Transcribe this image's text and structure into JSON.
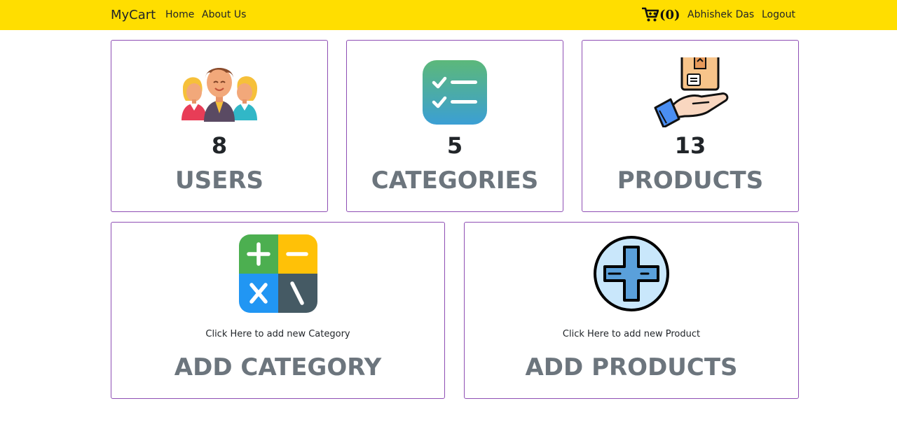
{
  "nav": {
    "brand": "MyCart",
    "links": [
      "Home",
      "About Us"
    ],
    "cart_count": "(0)",
    "user": "Abhishek Das",
    "logout": "Logout",
    "cart_icon": "cart-icon"
  },
  "stats": [
    {
      "icon": "users-icon",
      "count": "8",
      "title": "USERS"
    },
    {
      "icon": "checklist-icon",
      "count": "5",
      "title": "CATEGORIES"
    },
    {
      "icon": "product-hand-icon",
      "count": "13",
      "title": "PRODUCTS"
    }
  ],
  "actions": [
    {
      "icon": "calculator-icon",
      "hint": "Click Here to add new Category",
      "title": "ADD CATEGORY"
    },
    {
      "icon": "plus-circle-icon",
      "hint": "Click Here to add new Product",
      "title": "ADD PRODUCTS"
    }
  ],
  "colors": {
    "navbar": "#ffde00",
    "card_border": "#8e4eb4",
    "title": "#6c757d"
  }
}
